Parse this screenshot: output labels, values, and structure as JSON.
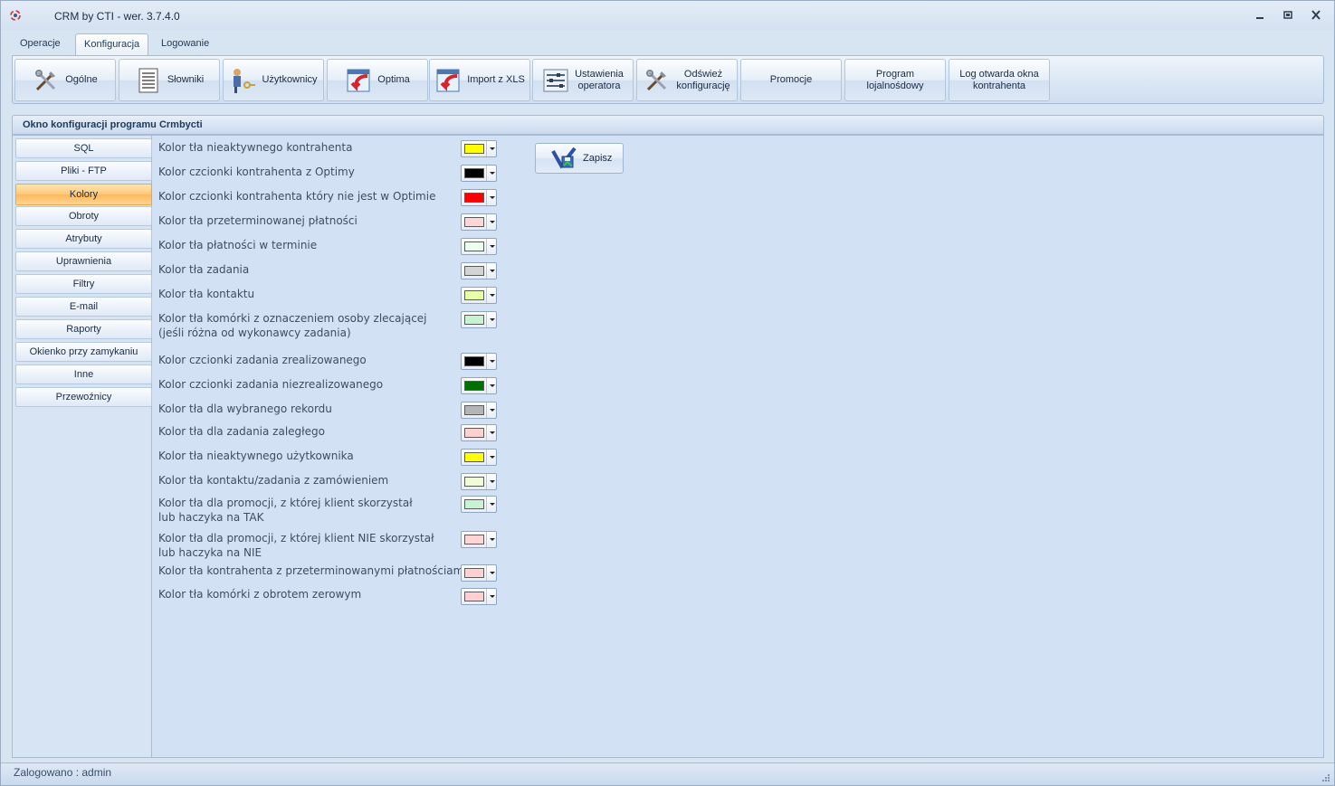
{
  "window": {
    "title": "CRM by CTI -  wer. 3.7.4.0",
    "icon": "app-logo-icon"
  },
  "ribbon_tabs": [
    {
      "label": "Operacje"
    },
    {
      "label": "Konfiguracja",
      "active": true
    },
    {
      "label": "Logowanie"
    }
  ],
  "ribbon_buttons": [
    {
      "label": "Ogólne",
      "icon": "tools-icon"
    },
    {
      "label": "Słowniki",
      "icon": "document-list-icon"
    },
    {
      "label": "Użytkownicy",
      "icon": "user-key-icon"
    },
    {
      "label": "Optima",
      "icon": "import-arrow-icon"
    },
    {
      "label": "Import z XLS",
      "icon": "import-arrow-icon"
    },
    {
      "label": "Ustawienia\noperatora",
      "icon": "sliders-icon"
    },
    {
      "label": "Odśwież\nkonfigurację",
      "icon": "tools-icon"
    },
    {
      "label": "Promocje",
      "icon": ""
    },
    {
      "label": "Program\nlojalnośdowy",
      "icon": ""
    },
    {
      "label": "Log otwarda okna\nkontrahenta",
      "icon": ""
    }
  ],
  "panel": {
    "title": "Okno konfiguracji programu Crmbycti"
  },
  "nav": [
    {
      "label": "SQL"
    },
    {
      "label": "Pliki - FTP"
    },
    {
      "label": "Kolory",
      "active": true
    },
    {
      "label": "Obroty"
    },
    {
      "label": "Atrybuty"
    },
    {
      "label": "Uprawnienia"
    },
    {
      "label": "Filtry"
    },
    {
      "label": "E-mail"
    },
    {
      "label": "Raporty"
    },
    {
      "label": "Okienko przy zamykaniu"
    },
    {
      "label": "Inne"
    },
    {
      "label": "Przewoźnicy"
    }
  ],
  "colors": [
    {
      "label": "Kolor tła nieaktywnego kontrahenta",
      "color": "#ffff00"
    },
    {
      "label": "Kolor czcionki kontrahenta z Optimy",
      "color": "#000000"
    },
    {
      "label": "Kolor czcionki kontrahenta który nie jest w Optimie",
      "color": "#ff0000"
    },
    {
      "label": "Kolor tła przeterminowanej płatności",
      "color": "#ffd6d6"
    },
    {
      "label": "Kolor tła płatności w terminie",
      "color": "#eefeee"
    },
    {
      "label": "Kolor tła zadania",
      "color": "#d4d4d4"
    },
    {
      "label": "Kolor tła kontaktu",
      "color": "#e8ffaa"
    },
    {
      "label": "Kolor tła komórki z oznaczeniem osoby zlecającej\n(jeśli różna od wykonawcy zadania)",
      "color": "#c4f5d0"
    },
    {
      "label": "Kolor czcionki zadania zrealizowanego",
      "color": "#000000"
    },
    {
      "label": "Kolor czcionki zadania niezrealizowanego",
      "color": "#007000"
    },
    {
      "label": "Kolor tła dla wybranego rekordu",
      "color": "#b5b5b5"
    },
    {
      "label": "Kolor tła dla zadania zaległego",
      "color": "#ffd0d0"
    },
    {
      "label": "Kolor tła nieaktywnego użytkownika",
      "color": "#ffff00"
    },
    {
      "label": "Kolor tła kontaktu/zadania z zamówieniem",
      "color": "#f0fcd8"
    },
    {
      "label": "Kolor tła dla promocji, z której klient skorzystał\nlub haczyka na TAK",
      "color": "#c4f5d0"
    },
    {
      "label": "Kolor tła dla promocji, z której klient NIE skorzystał\nlub haczyka na NIE",
      "color": "#ffd6d6"
    },
    {
      "label": "Kolor tła kontrahenta z przeterminowanymi płatnościami",
      "color": "#ffd0d0"
    },
    {
      "label": "Kolor tła komórki z obrotem zerowym",
      "color": "#ffd0d0"
    }
  ],
  "save_button": {
    "label": "Zapisz",
    "icon": "save-disk-icon"
  },
  "status": {
    "text": "Zalogowano : admin"
  }
}
